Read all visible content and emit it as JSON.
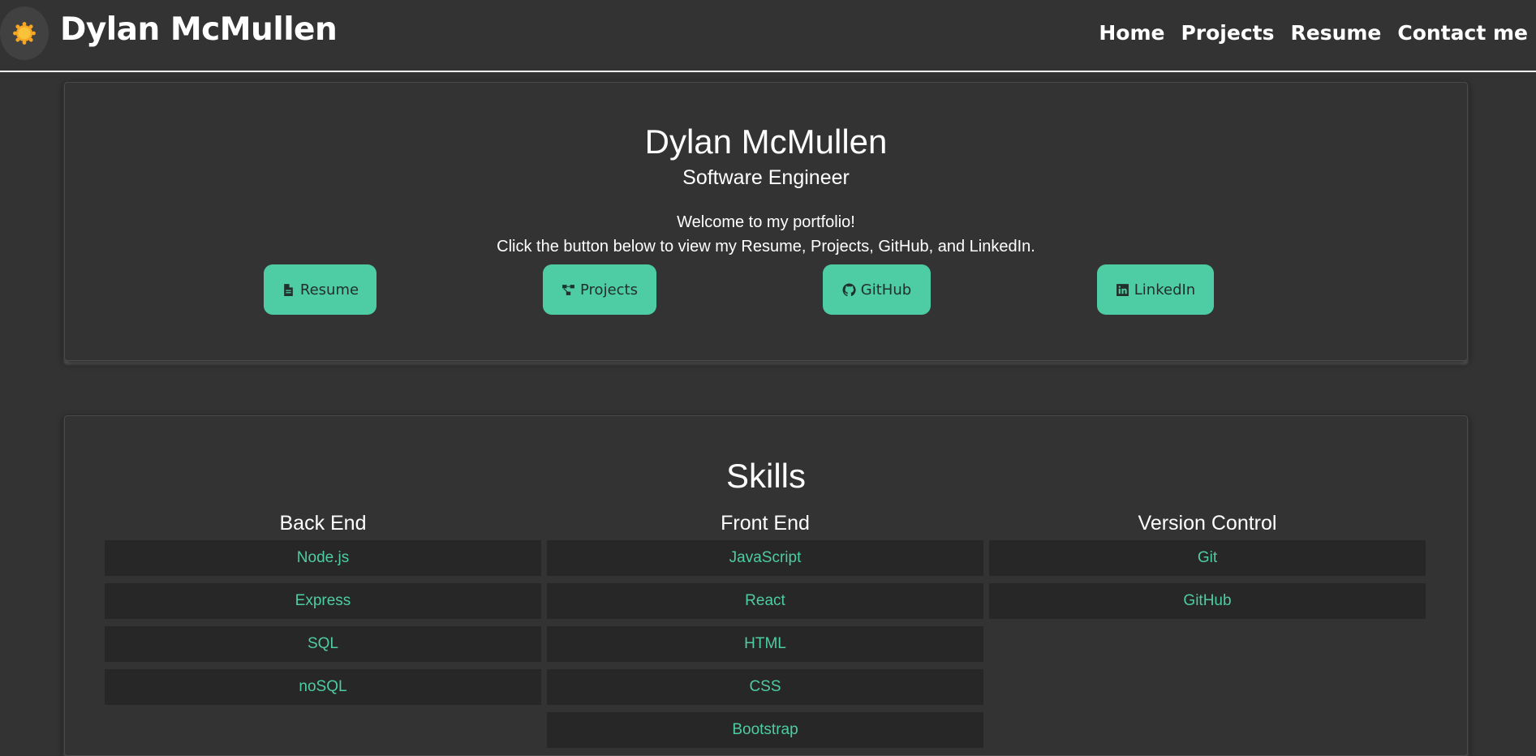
{
  "header": {
    "brand": "Dylan McMullen",
    "logo_icon": "sun-icon",
    "nav": [
      "Home",
      "Projects",
      "Resume",
      "Contact me"
    ]
  },
  "hero": {
    "name": "Dylan McMullen",
    "role": "Software Engineer",
    "welcome_line1": "Welcome to my portfolio!",
    "welcome_line2": "Click the button below to view my Resume, Projects, GitHub, and LinkedIn.",
    "buttons": [
      {
        "label": "Resume",
        "icon": "file-icon"
      },
      {
        "label": "Projects",
        "icon": "project-diagram-icon"
      },
      {
        "label": "GitHub",
        "icon": "github-icon"
      },
      {
        "label": "LinkedIn",
        "icon": "linkedin-icon"
      }
    ]
  },
  "skills": {
    "title": "Skills",
    "columns": [
      {
        "heading": "Back End",
        "items": [
          "Node.js",
          "Express",
          "SQL",
          "noSQL"
        ]
      },
      {
        "heading": "Front End",
        "items": [
          "JavaScript",
          "React",
          "HTML",
          "CSS",
          "Bootstrap"
        ]
      },
      {
        "heading": "Version Control",
        "items": [
          "Git",
          "GitHub"
        ]
      }
    ]
  },
  "colors": {
    "background": "#333333",
    "accent": "#4ecca3",
    "skill_cell": "#272727"
  }
}
